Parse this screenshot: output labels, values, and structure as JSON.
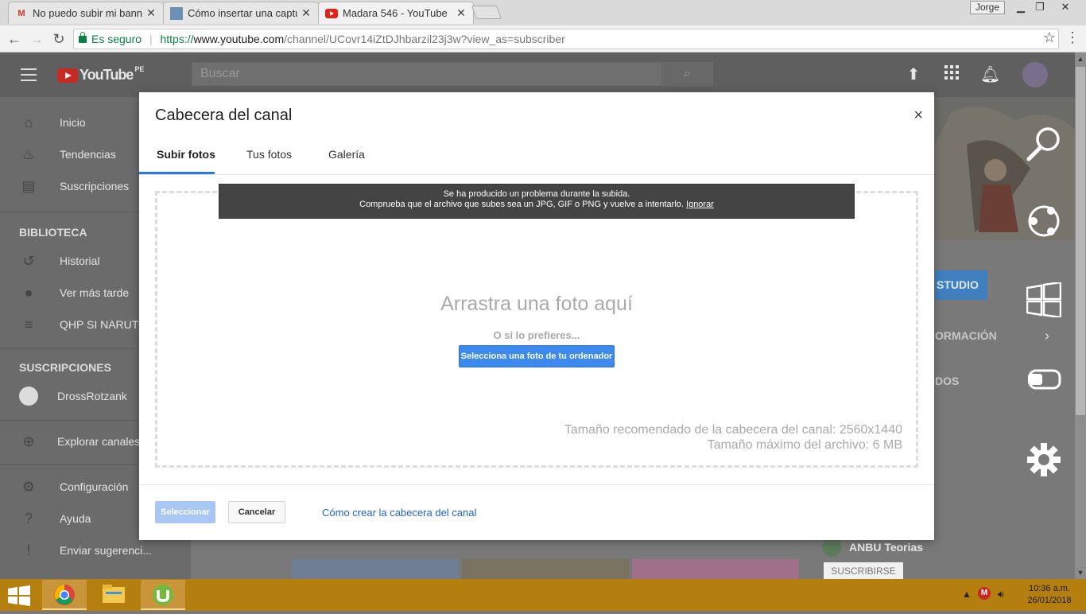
{
  "browser": {
    "tabs": [
      {
        "title": "No puedo subir mi banner",
        "icon": "gmail-icon"
      },
      {
        "title": "Cómo insertar una captura",
        "icon": "photo-icon"
      },
      {
        "title": "Madara 546 - YouTube",
        "icon": "youtube-icon"
      }
    ],
    "profile": "Jorge",
    "secure_label": "Es seguro",
    "url": {
      "scheme": "https://",
      "host": "www.youtube.com",
      "path": "/channel/UCovr14iZtDJhbarzil23j3w?view_as=subscriber"
    }
  },
  "youtube": {
    "logo_text": "YouTube",
    "country": "PE",
    "search_placeholder": "Buscar",
    "sidebar": {
      "main": [
        {
          "label": "Inicio",
          "icon": "home-icon"
        },
        {
          "label": "Tendencias",
          "icon": "flame-icon"
        },
        {
          "label": "Suscripciones",
          "icon": "subscriptions-icon"
        }
      ],
      "library_title": "BIBLIOTECA",
      "library": [
        {
          "label": "Historial",
          "icon": "history-icon"
        },
        {
          "label": "Ver más tarde",
          "icon": "clock-icon"
        },
        {
          "label": "QHP SI NARUTO",
          "icon": "playlist-icon"
        }
      ],
      "subs_title": "SUSCRIPCIONES",
      "subs": [
        {
          "label": "DrossRotzank",
          "icon": "channel-avatar"
        }
      ],
      "explore": "Explorar canales",
      "bottom": [
        {
          "label": "Configuración",
          "icon": "gear-icon"
        },
        {
          "label": "Ayuda",
          "icon": "help-icon"
        },
        {
          "label": "Enviar sugerenci...",
          "icon": "feedback-icon"
        }
      ]
    },
    "studio_button": "STUDIO",
    "info_link": "ORMACIÓN",
    "dos_link": "DOS",
    "related_channel": "ANBU Teorias",
    "subscribe_button": "SUSCRIBIRSE"
  },
  "dialog": {
    "title": "Cabecera del canal",
    "tabs": [
      "Subir fotos",
      "Tus fotos",
      "Galería"
    ],
    "error_line1": "Se ha producido un problema durante la subida.",
    "error_line2": "Comprueba que el archivo que subes sea un JPG, GIF o PNG y vuelve a intentarlo.",
    "error_ignore": "Ignorar",
    "drag_text": "Arrastra una foto aquí",
    "or_text": "O si lo prefieres...",
    "select_photo_button": "Selecciona una foto de tu ordenador",
    "recommended_size": "Tamaño recomendado de la cabecera del canal: 2560x1440",
    "max_size": "Tamaño máximo del archivo: 6 MB",
    "select_button": "Seleccionar",
    "cancel_button": "Cancelar",
    "help_link": "Cómo crear la cabecera del canal"
  },
  "taskbar": {
    "time": "10:36 a.m.",
    "date": "26/01/2018"
  },
  "colors": {
    "accent": "#3c8af0",
    "taskbar": "#b57f10",
    "youtube_red": "#c62a25"
  }
}
